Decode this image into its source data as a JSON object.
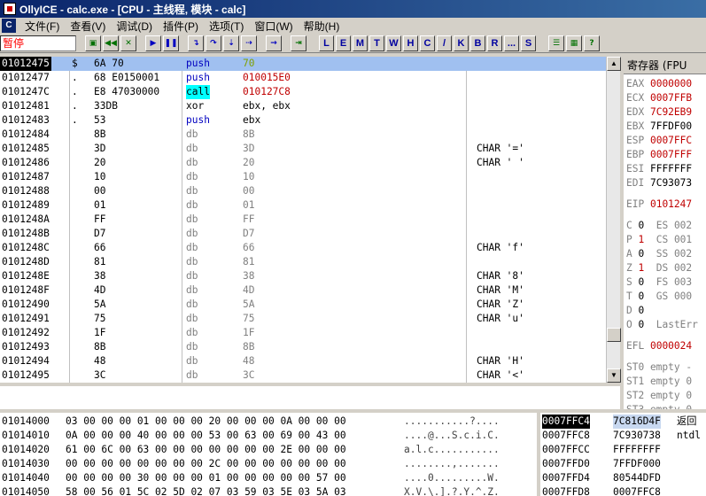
{
  "window": {
    "title": "OllyICE - calc.exe - [CPU - 主线程, 模块 - calc]"
  },
  "menu": [
    "文件(F)",
    "查看(V)",
    "调试(D)",
    "插件(P)",
    "选项(T)",
    "窗口(W)",
    "帮助(H)"
  ],
  "status": "暂停",
  "toolbar": {
    "icons": [
      "open-file-icon",
      "restart-icon",
      "close-process-icon",
      "run-icon",
      "pause-icon",
      "step-into-icon",
      "step-over-icon",
      "trace-into-icon",
      "trace-over-icon",
      "execute-till-return-icon",
      "goto-icon"
    ],
    "letters": [
      "L",
      "E",
      "M",
      "T",
      "W",
      "H",
      "C",
      "/",
      "K",
      "B",
      "R",
      "...",
      "S"
    ],
    "extra_icons": [
      "list-icon",
      "grid-icon",
      "help-icon"
    ],
    "colors": {
      "accent": "#0a246a",
      "selection": "#a0c0f0",
      "push": "#0000c0",
      "call_bg": "#00ffff",
      "addr_red": "#c00000"
    }
  },
  "cpu": {
    "rows": [
      {
        "addr": "01012475",
        "mark": "$",
        "hex": "6A 70",
        "op": "push",
        "arg": "70",
        "comment": "",
        "kind": "push",
        "argc": "green",
        "sel": true
      },
      {
        "addr": "01012477",
        "mark": ".",
        "hex": "68 E0150001",
        "op": "push",
        "arg": "010015E0",
        "comment": "",
        "kind": "push",
        "argc": "red"
      },
      {
        "addr": "0101247C",
        "mark": ".",
        "hex": "E8 47030000",
        "op": "call",
        "arg": "010127C8",
        "comment": "",
        "kind": "call",
        "argc": "red"
      },
      {
        "addr": "01012481",
        "mark": ".",
        "hex": "33DB",
        "op": "xor",
        "arg": "ebx, ebx",
        "comment": "",
        "kind": "plain",
        "argc": ""
      },
      {
        "addr": "01012483",
        "mark": ".",
        "hex": "53",
        "op": "push",
        "arg": "ebx",
        "comment": "",
        "kind": "push",
        "argc": ""
      },
      {
        "addr": "01012484",
        "mark": "",
        "hex": "8B",
        "op": "db",
        "arg": "8B",
        "comment": "",
        "kind": "db",
        "argc": "grey"
      },
      {
        "addr": "01012485",
        "mark": "",
        "hex": "3D",
        "op": "db",
        "arg": "3D",
        "comment": "CHAR '='",
        "kind": "db",
        "argc": "grey"
      },
      {
        "addr": "01012486",
        "mark": "",
        "hex": "20",
        "op": "db",
        "arg": "20",
        "comment": "CHAR ' '",
        "kind": "db",
        "argc": "grey"
      },
      {
        "addr": "01012487",
        "mark": "",
        "hex": "10",
        "op": "db",
        "arg": "10",
        "comment": "",
        "kind": "db",
        "argc": "grey"
      },
      {
        "addr": "01012488",
        "mark": "",
        "hex": "00",
        "op": "db",
        "arg": "00",
        "comment": "",
        "kind": "db",
        "argc": "grey"
      },
      {
        "addr": "01012489",
        "mark": "",
        "hex": "01",
        "op": "db",
        "arg": "01",
        "comment": "",
        "kind": "db",
        "argc": "grey"
      },
      {
        "addr": "0101248A",
        "mark": "",
        "hex": "FF",
        "op": "db",
        "arg": "FF",
        "comment": "",
        "kind": "db",
        "argc": "grey"
      },
      {
        "addr": "0101248B",
        "mark": "",
        "hex": "D7",
        "op": "db",
        "arg": "D7",
        "comment": "",
        "kind": "db",
        "argc": "grey"
      },
      {
        "addr": "0101248C",
        "mark": "",
        "hex": "66",
        "op": "db",
        "arg": "66",
        "comment": "CHAR 'f'",
        "kind": "db",
        "argc": "grey"
      },
      {
        "addr": "0101248D",
        "mark": "",
        "hex": "81",
        "op": "db",
        "arg": "81",
        "comment": "",
        "kind": "db",
        "argc": "grey"
      },
      {
        "addr": "0101248E",
        "mark": "",
        "hex": "38",
        "op": "db",
        "arg": "38",
        "comment": "CHAR '8'",
        "kind": "db",
        "argc": "grey"
      },
      {
        "addr": "0101248F",
        "mark": "",
        "hex": "4D",
        "op": "db",
        "arg": "4D",
        "comment": "CHAR 'M'",
        "kind": "db",
        "argc": "grey"
      },
      {
        "addr": "01012490",
        "mark": "",
        "hex": "5A",
        "op": "db",
        "arg": "5A",
        "comment": "CHAR 'Z'",
        "kind": "db",
        "argc": "grey"
      },
      {
        "addr": "01012491",
        "mark": "",
        "hex": "75",
        "op": "db",
        "arg": "75",
        "comment": "CHAR 'u'",
        "kind": "db",
        "argc": "grey"
      },
      {
        "addr": "01012492",
        "mark": "",
        "hex": "1F",
        "op": "db",
        "arg": "1F",
        "comment": "",
        "kind": "db",
        "argc": "grey"
      },
      {
        "addr": "01012493",
        "mark": "",
        "hex": "8B",
        "op": "db",
        "arg": "8B",
        "comment": "",
        "kind": "db",
        "argc": "grey"
      },
      {
        "addr": "01012494",
        "mark": "",
        "hex": "48",
        "op": "db",
        "arg": "48",
        "comment": "CHAR 'H'",
        "kind": "db",
        "argc": "grey"
      },
      {
        "addr": "01012495",
        "mark": "",
        "hex": "3C",
        "op": "db",
        "arg": "3C",
        "comment": "CHAR '<'",
        "kind": "db",
        "argc": "grey"
      }
    ]
  },
  "registers": {
    "header": "寄存器 (FPU",
    "gpr": [
      {
        "name": "EAX",
        "value": "0000000",
        "red": true
      },
      {
        "name": "ECX",
        "value": "0007FFB",
        "red": true
      },
      {
        "name": "EDX",
        "value": "7C92EB9",
        "red": true
      },
      {
        "name": "EBX",
        "value": "7FFDF00",
        "red": false
      },
      {
        "name": "ESP",
        "value": "0007FFC",
        "red": true
      },
      {
        "name": "EBP",
        "value": "0007FFF",
        "red": true
      },
      {
        "name": "ESI",
        "value": "FFFFFFF",
        "red": false
      },
      {
        "name": "EDI",
        "value": "7C93073",
        "red": false
      }
    ],
    "eip": {
      "name": "EIP",
      "value": "0101247",
      "red": true
    },
    "flags": [
      {
        "f": "C",
        "v": "0",
        "seg": "ES 002",
        "red": false
      },
      {
        "f": "P",
        "v": "1",
        "seg": "CS 001",
        "red": true
      },
      {
        "f": "A",
        "v": "0",
        "seg": "SS 002",
        "red": false
      },
      {
        "f": "Z",
        "v": "1",
        "seg": "DS 002",
        "red": true
      },
      {
        "f": "S",
        "v": "0",
        "seg": "FS 003",
        "red": false
      },
      {
        "f": "T",
        "v": "0",
        "seg": "GS 000",
        "red": false
      },
      {
        "f": "D",
        "v": "0",
        "seg": "",
        "red": false
      },
      {
        "f": "O",
        "v": "0",
        "seg": "LastErr",
        "red": false
      }
    ],
    "efl": {
      "name": "EFL",
      "value": "0000024",
      "red": true
    },
    "fpu": [
      "ST0 empty -",
      "ST1 empty 0",
      "ST2 empty 0",
      "ST3 empty 0"
    ]
  },
  "dump": {
    "rows": [
      {
        "addr": "01014000",
        "hex": "03 00 00 00 01 00 00 00 20 00 00 00 0A 00 00 00",
        "ascii": "...........?...."
      },
      {
        "addr": "01014010",
        "hex": "0A 00 00 00 40 00 00 00 53 00 63 00 69 00 43 00",
        "ascii": "....@...S.c.i.C."
      },
      {
        "addr": "01014020",
        "hex": "61 00 6C 00 63 00 00 00 00 00 00 00 2E 00 00 00",
        "ascii": "a.l.c..........."
      },
      {
        "addr": "01014030",
        "hex": "00 00 00 00 00 00 00 00 2C 00 00 00 00 00 00 00",
        "ascii": "........,......."
      },
      {
        "addr": "01014040",
        "hex": "00 00 00 00 30 00 00 00 01 00 00 00 00 00 57 00",
        "ascii": "....0.........W."
      },
      {
        "addr": "01014050",
        "hex": "58 00 56 01 5C 02 5D 02 07 03 59 03 5E 03 5A 03",
        "ascii": "X.V.\\.].?.Y.^.Z."
      }
    ]
  },
  "stack": {
    "rows": [
      {
        "addr": "0007FFC4",
        "val": "7C816D4F",
        "com": "返回",
        "sel": true
      },
      {
        "addr": "0007FFC8",
        "val": "7C930738",
        "com": "ntdl",
        "sel": false
      },
      {
        "addr": "0007FFCC",
        "val": "FFFFFFFF",
        "com": "",
        "sel": false
      },
      {
        "addr": "0007FFD0",
        "val": "7FFDF000",
        "com": "",
        "sel": false
      },
      {
        "addr": "0007FFD4",
        "val": "80544DFD",
        "com": "",
        "sel": false
      },
      {
        "addr": "0007FFD8",
        "val": "0007FFC8",
        "com": "",
        "sel": false
      }
    ]
  }
}
